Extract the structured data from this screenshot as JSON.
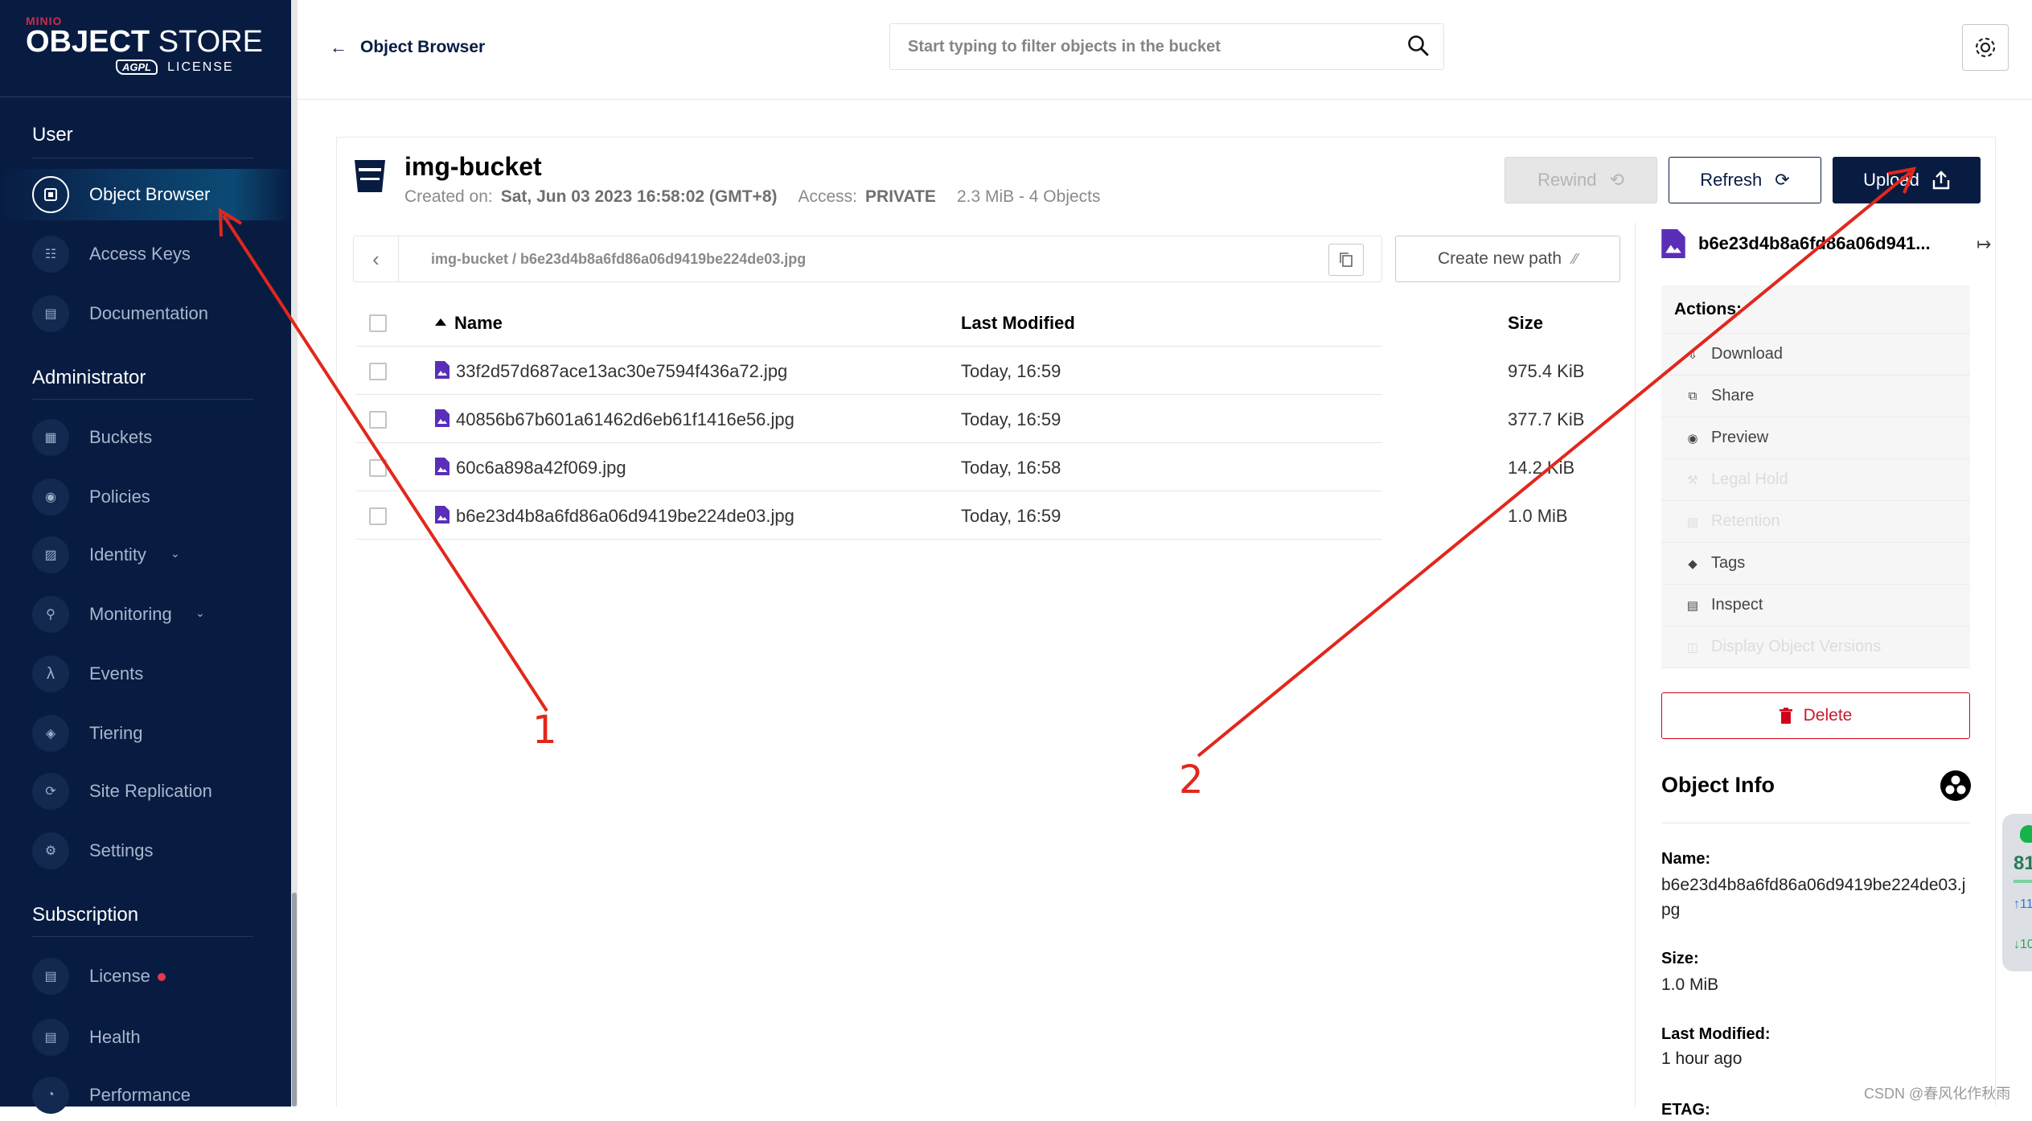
{
  "brand": {
    "top": "MINIO",
    "name_bold": "OBJECT",
    "name_light": " STORE",
    "badge": "AGPL",
    "license": "LICENSE"
  },
  "sidebar": {
    "sections": [
      {
        "title": "User",
        "items": [
          {
            "label": "Object Browser",
            "icon": "folder-icon",
            "active": true
          },
          {
            "label": "Access Keys",
            "icon": "key-icon"
          },
          {
            "label": "Documentation",
            "icon": "document-icon"
          }
        ]
      },
      {
        "title": "Administrator",
        "items": [
          {
            "label": "Buckets",
            "icon": "bucket-icon"
          },
          {
            "label": "Policies",
            "icon": "lock-icon"
          },
          {
            "label": "Identity",
            "icon": "id-card-icon",
            "chevron": true
          },
          {
            "label": "Monitoring",
            "icon": "magnifier-icon",
            "chevron": true
          },
          {
            "label": "Events",
            "icon": "lambda-icon"
          },
          {
            "label": "Tiering",
            "icon": "layers-icon"
          },
          {
            "label": "Site Replication",
            "icon": "replicate-icon"
          },
          {
            "label": "Settings",
            "icon": "gear-icon"
          }
        ]
      },
      {
        "title": "Subscription",
        "items": [
          {
            "label": "License",
            "icon": "certificate-icon",
            "dot": true
          },
          {
            "label": "Health",
            "icon": "health-icon"
          },
          {
            "label": "Performance",
            "icon": "speedometer-icon"
          }
        ]
      }
    ]
  },
  "header": {
    "back_label": "Object Browser",
    "search_placeholder": "Start typing to filter objects in the bucket"
  },
  "bucket": {
    "name": "img-bucket",
    "created_label": "Created on:",
    "created_value": "Sat, Jun 03 2023 16:58:02 (GMT+8)",
    "access_label": "Access:",
    "access_value": "PRIVATE",
    "summary": "2.3 MiB - 4 Objects"
  },
  "toolbar": {
    "rewind": "Rewind",
    "refresh": "Refresh",
    "upload": "Upload"
  },
  "breadcrumb": {
    "path": "img-bucket  /  b6e23d4b8a6fd86a06d9419be224de03.jpg",
    "new_path": "Create new path"
  },
  "table": {
    "headers": {
      "name": "Name",
      "modified": "Last Modified",
      "size": "Size"
    },
    "rows": [
      {
        "name": "33f2d57d687ace13ac30e7594f436a72.jpg",
        "modified": "Today, 16:59",
        "size": "975.4 KiB"
      },
      {
        "name": "40856b67b601a61462d6eb61f1416e56.jpg",
        "modified": "Today, 16:59",
        "size": "377.7 KiB"
      },
      {
        "name": "60c6a898a42f069.jpg",
        "modified": "Today, 16:58",
        "size": "14.2 KiB"
      },
      {
        "name": "b6e23d4b8a6fd86a06d9419be224de03.jpg",
        "modified": "Today, 16:59",
        "size": "1.0 MiB"
      }
    ]
  },
  "details": {
    "title": "b6e23d4b8a6fd86a06d941...",
    "actions_title": "Actions:",
    "actions": [
      {
        "label": "Download",
        "icon": "download-icon",
        "enabled": true
      },
      {
        "label": "Share",
        "icon": "share-icon",
        "enabled": true
      },
      {
        "label": "Preview",
        "icon": "eye-icon",
        "enabled": true
      },
      {
        "label": "Legal Hold",
        "icon": "gavel-icon",
        "enabled": false
      },
      {
        "label": "Retention",
        "icon": "retention-icon",
        "enabled": false
      },
      {
        "label": "Tags",
        "icon": "tag-icon",
        "enabled": true
      },
      {
        "label": "Inspect",
        "icon": "inspect-icon",
        "enabled": true
      },
      {
        "label": "Display Object Versions",
        "icon": "versions-icon",
        "enabled": false
      }
    ],
    "delete": "Delete",
    "info_title": "Object Info",
    "name_label": "Name:",
    "name_value": "b6e23d4b8a6fd86a06d9419be224de03.jpg",
    "size_label": "Size:",
    "size_value": "1.0 MiB",
    "modified_label": "Last Modified:",
    "modified_value": "1 hour ago",
    "etag_label": "ETAG:"
  },
  "widget": {
    "percent": "81",
    "up": "11",
    "down": "10"
  },
  "annotations": {
    "one": "1",
    "two": "2",
    "color": "#e2271c"
  },
  "watermark": "CSDN @春风化作秋雨",
  "colors": {
    "sidebar_bg": "#081c42",
    "primary": "#081c42",
    "danger": "#c51b2f",
    "file_icon": "#5a2fb8"
  }
}
